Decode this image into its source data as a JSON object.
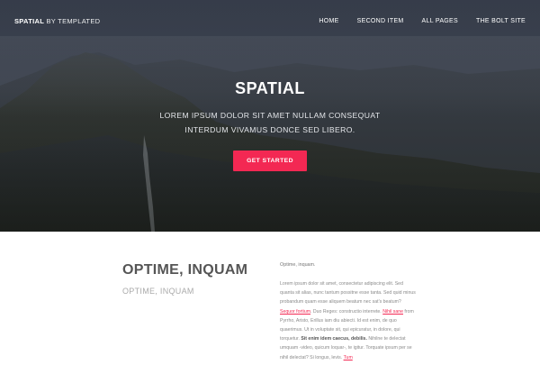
{
  "header": {
    "brand_bold": "SPATIAL",
    "brand_rest": "BY TEMPLATED",
    "nav": [
      "HOME",
      "SECOND ITEM",
      "ALL PAGES",
      "THE BOLT SITE"
    ]
  },
  "hero": {
    "title": "SPATIAL",
    "subtitle_line1": "LOREM IPSUM DOLOR SIT AMET NULLAM CONSEQUAT",
    "subtitle_line2": "INTERDUM VIVAMUS DONCE SED LIBERO.",
    "cta": "GET STARTED"
  },
  "section": {
    "title": "OPTIME, INQUAM",
    "subtitle": "OPTIME, INQUAM",
    "small_heading": "Optime, inquam.",
    "paragraph": {
      "t1": "Lorem ipsum dolor sit amet, consectetur adipiscing elit. Sed quanta sit alias, nunc tantum possitne esse tanta. Sed quid minus probandum quam esse aliquem beatum nec sat's beatum?",
      "link1": "Sequor fortium",
      "t2": ". Duo Reges: constructio interrete.",
      "link2": "Nihil sane",
      "t3": " from Pyrrho, Aristo, Erillus iam diu abiecti. Id est enim, de quo quaerimus. Ut in voluptate sit, qui epicuratur, in dolore, qui torquetur.",
      "bold1": " Sit enim idem caecus, debilis.",
      "t4": " Nihilne te delectat umquam -video, quicum loquar-, te igitur. Torquate ipsum per se nihil delectat? Si longus, levis.",
      "link3": "Tum"
    }
  },
  "colors": {
    "accent": "#f32853",
    "hero_bg": "#3a4150"
  }
}
